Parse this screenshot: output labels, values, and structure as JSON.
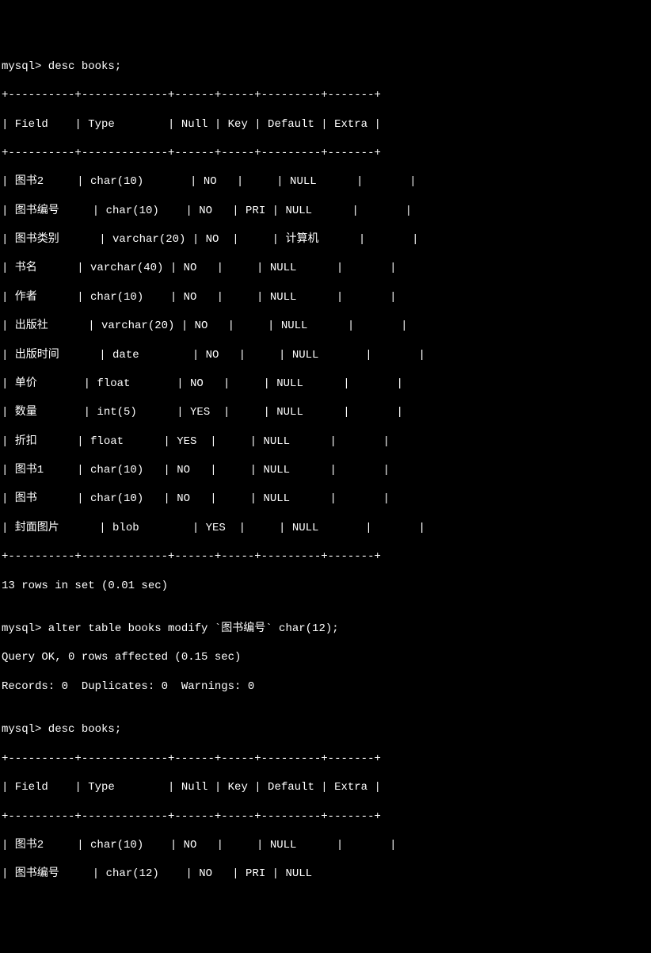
{
  "command1": "mysql> desc books;",
  "table1": {
    "separator_top": "+----------+-------------+------+-----+---------+-------+",
    "header": "| Field    | Type        | Null | Key | Default | Extra |",
    "separator_mid": "+----------+-------------+------+-----+---------+-------+",
    "rows": [
      "| 图书2     | char(10)       | NO   |     | NULL      |       |",
      "| 图书编号     | char(10)    | NO   | PRI | NULL      |       |",
      "| 图书类别      | varchar(20) | NO  |     | 计算机      |       |",
      "| 书名      | varchar(40) | NO   |     | NULL      |       |",
      "| 作者      | char(10)    | NO   |     | NULL      |       |",
      "| 出版社      | varchar(20) | NO   |     | NULL      |       |",
      "| 出版时间      | date        | NO   |     | NULL       |       |",
      "| 单价       | float       | NO   |     | NULL      |       |",
      "| 数量       | int(5)      | YES  |     | NULL      |       |",
      "| 折扣      | float      | YES  |     | NULL      |       |",
      "| 图书1     | char(10)   | NO   |     | NULL      |       |",
      "| 图书      | char(10)   | NO   |     | NULL      |       |",
      "| 封面图片      | blob        | YES  |     | NULL       |       |"
    ],
    "separator_bottom": "+----------+-------------+------+-----+---------+-------+"
  },
  "result1": "13 rows in set (0.01 sec)",
  "blank1": "",
  "command2": "mysql> alter table books modify `图书编号` char(12);",
  "result2a": "Query OK, 0 rows affected (0.15 sec)",
  "result2b": "Records: 0  Duplicates: 0  Warnings: 0",
  "blank2": "",
  "command3": "mysql> desc books;",
  "table2": {
    "separator_top": "+----------+-------------+------+-----+---------+-------+",
    "header": "| Field    | Type        | Null | Key | Default | Extra |",
    "separator_mid": "+----------+-------------+------+-----+---------+-------+",
    "rows": [
      "| 图书2     | char(10)    | NO   |     | NULL      |       |",
      "| 图书编号     | char(12)    | NO   | PRI | NULL      "
    ]
  }
}
